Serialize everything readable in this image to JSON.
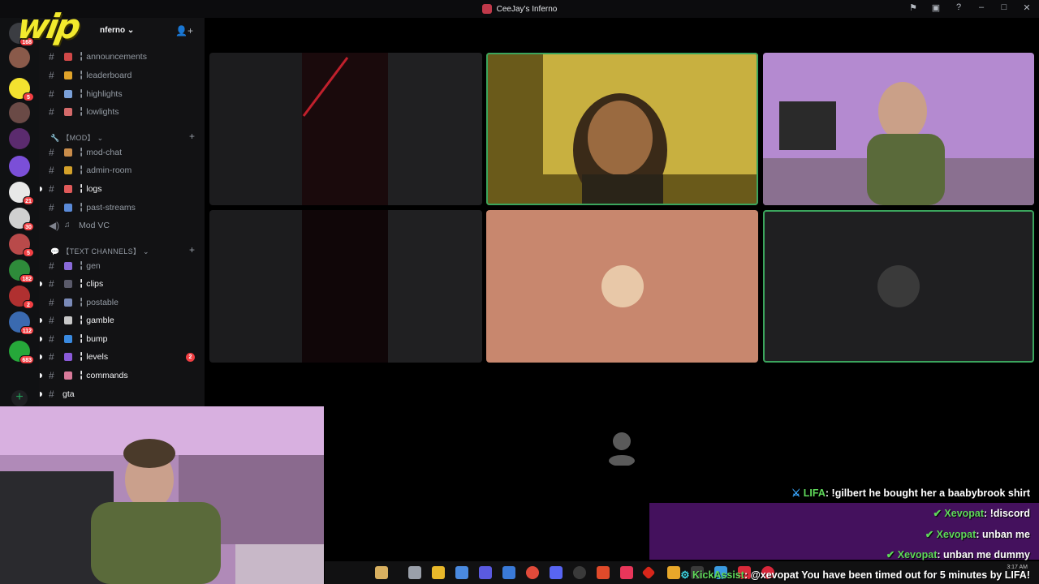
{
  "window": {
    "title": "CeeJay's Inferno"
  },
  "overlay_logo": "wip",
  "server": {
    "name": "CeeJay's Inferno",
    "name_visible": "nferno"
  },
  "server_rail": {
    "badges": [
      "168",
      "5",
      "21",
      "30",
      "5",
      "182",
      "2",
      "112",
      "683"
    ]
  },
  "channels": [
    {
      "id": "announcements",
      "label": "╏ announcements",
      "bold": false
    },
    {
      "id": "leaderboard",
      "label": "╏ leaderboard",
      "bold": false
    },
    {
      "id": "highlights",
      "label": "╏ highlights",
      "bold": false
    },
    {
      "id": "lowlights",
      "label": "╏ lowlights",
      "bold": false
    },
    {
      "id": "mod-chat",
      "label": "╏ mod-chat",
      "bold": false
    },
    {
      "id": "admin-room",
      "label": "╏ admin-room",
      "bold": false
    },
    {
      "id": "logs",
      "label": "╏ logs",
      "bold": true
    },
    {
      "id": "past-streams",
      "label": "╏ past-streams",
      "bold": false
    },
    {
      "id": "mod-vc",
      "label": "Mod VC",
      "bold": false
    },
    {
      "id": "gen",
      "label": "╏ gen",
      "bold": false
    },
    {
      "id": "clips",
      "label": "╏ clips",
      "bold": true
    },
    {
      "id": "postable",
      "label": "╏ postable",
      "bold": false
    },
    {
      "id": "gamble",
      "label": "╏ gamble",
      "bold": true
    },
    {
      "id": "bump",
      "label": "╏ bump",
      "bold": true
    },
    {
      "id": "levels",
      "label": "╏ levels",
      "bold": true,
      "unread": "2"
    },
    {
      "id": "commands",
      "label": "╏ commands",
      "bold": true
    },
    {
      "id": "gta",
      "label": "gta",
      "bold": true
    }
  ],
  "categories": {
    "mod": "【MOD】",
    "text": "【TEXT CHANNELS】"
  },
  "chat": [
    {
      "user": "LIFA",
      "message": "!gilbert he bought her a baabybrook shirt",
      "badge": "sword"
    },
    {
      "user": "Xevopat",
      "message": "!discord",
      "badge": "check"
    },
    {
      "user": "Xevopat",
      "message": "unban me",
      "badge": "check"
    },
    {
      "user": "Xevopat",
      "message": "unban me dummy",
      "badge": "check"
    },
    {
      "user": "KickAssist",
      "message": "@xevopat You have been timed out for 5 minutes by LIFA!",
      "badge": "robot"
    }
  ],
  "clock": {
    "time": "3:17 AM"
  },
  "colors": {
    "speaking": "#3ba55d",
    "chat_band": "#4a1265",
    "logo": "#f3ea2d",
    "unread": "#f23f43"
  }
}
